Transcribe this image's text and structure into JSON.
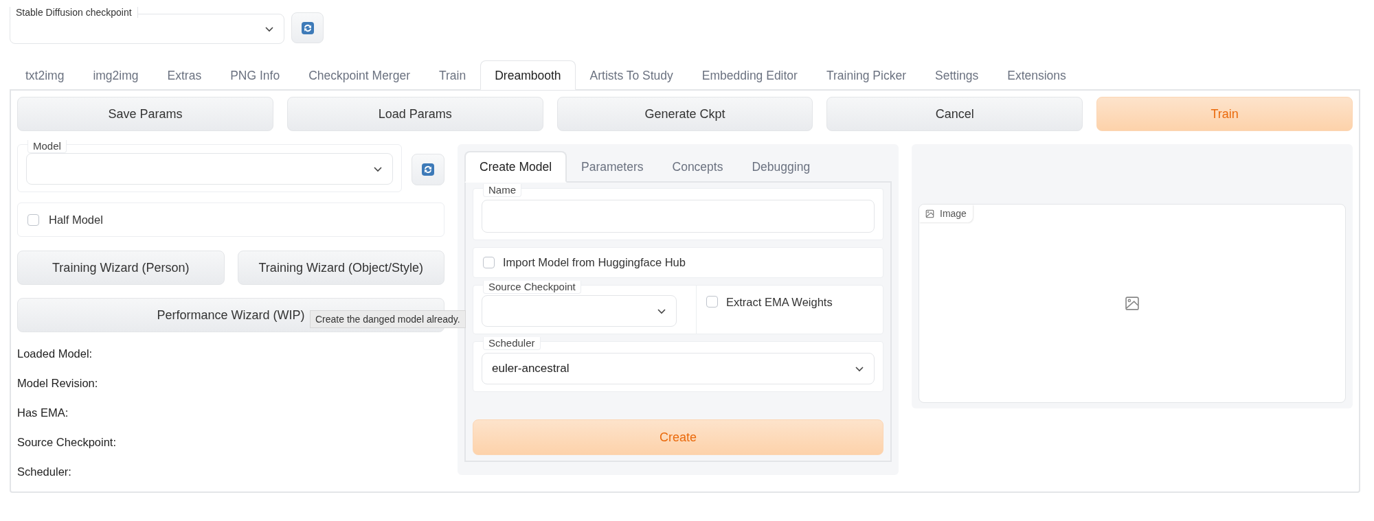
{
  "checkpoint": {
    "label": "Stable Diffusion checkpoint"
  },
  "tabs": [
    {
      "label": "txt2img",
      "selected": false
    },
    {
      "label": "img2img",
      "selected": false
    },
    {
      "label": "Extras",
      "selected": false
    },
    {
      "label": "PNG Info",
      "selected": false
    },
    {
      "label": "Checkpoint Merger",
      "selected": false
    },
    {
      "label": "Train",
      "selected": false
    },
    {
      "label": "Dreambooth",
      "selected": true
    },
    {
      "label": "Artists To Study",
      "selected": false
    },
    {
      "label": "Embedding Editor",
      "selected": false
    },
    {
      "label": "Training Picker",
      "selected": false
    },
    {
      "label": "Settings",
      "selected": false
    },
    {
      "label": "Extensions",
      "selected": false
    }
  ],
  "actions": [
    {
      "label": "Save Params",
      "kind": "secondary"
    },
    {
      "label": "Load Params",
      "kind": "secondary"
    },
    {
      "label": "Generate Ckpt",
      "kind": "secondary"
    },
    {
      "label": "Cancel",
      "kind": "secondary"
    },
    {
      "label": "Train",
      "kind": "primary"
    }
  ],
  "model": {
    "label": "Model"
  },
  "half_model": {
    "label": "Half Model",
    "checked": false
  },
  "wizards": [
    "Training Wizard (Person)",
    "Training Wizard (Object/Style)"
  ],
  "performance_wizard": {
    "label": "Performance Wizard (WIP)",
    "tooltip": "Create the danged model already."
  },
  "info": [
    "Loaded Model:",
    "Model Revision:",
    "Has EMA:",
    "Source Checkpoint:",
    "Scheduler:"
  ],
  "subtabs": [
    {
      "label": "Create Model",
      "selected": true
    },
    {
      "label": "Parameters",
      "selected": false
    },
    {
      "label": "Concepts",
      "selected": false
    },
    {
      "label": "Debugging",
      "selected": false
    }
  ],
  "create_model": {
    "name_label": "Name",
    "import_hub": {
      "label": "Import Model from Huggingface Hub",
      "checked": false
    },
    "source_checkpoint_label": "Source Checkpoint",
    "extract_ema": {
      "label": "Extract EMA Weights",
      "checked": false
    },
    "scheduler": {
      "label": "Scheduler",
      "value": "euler-ancestral"
    },
    "create_button": "Create"
  },
  "image": {
    "label": "Image"
  }
}
